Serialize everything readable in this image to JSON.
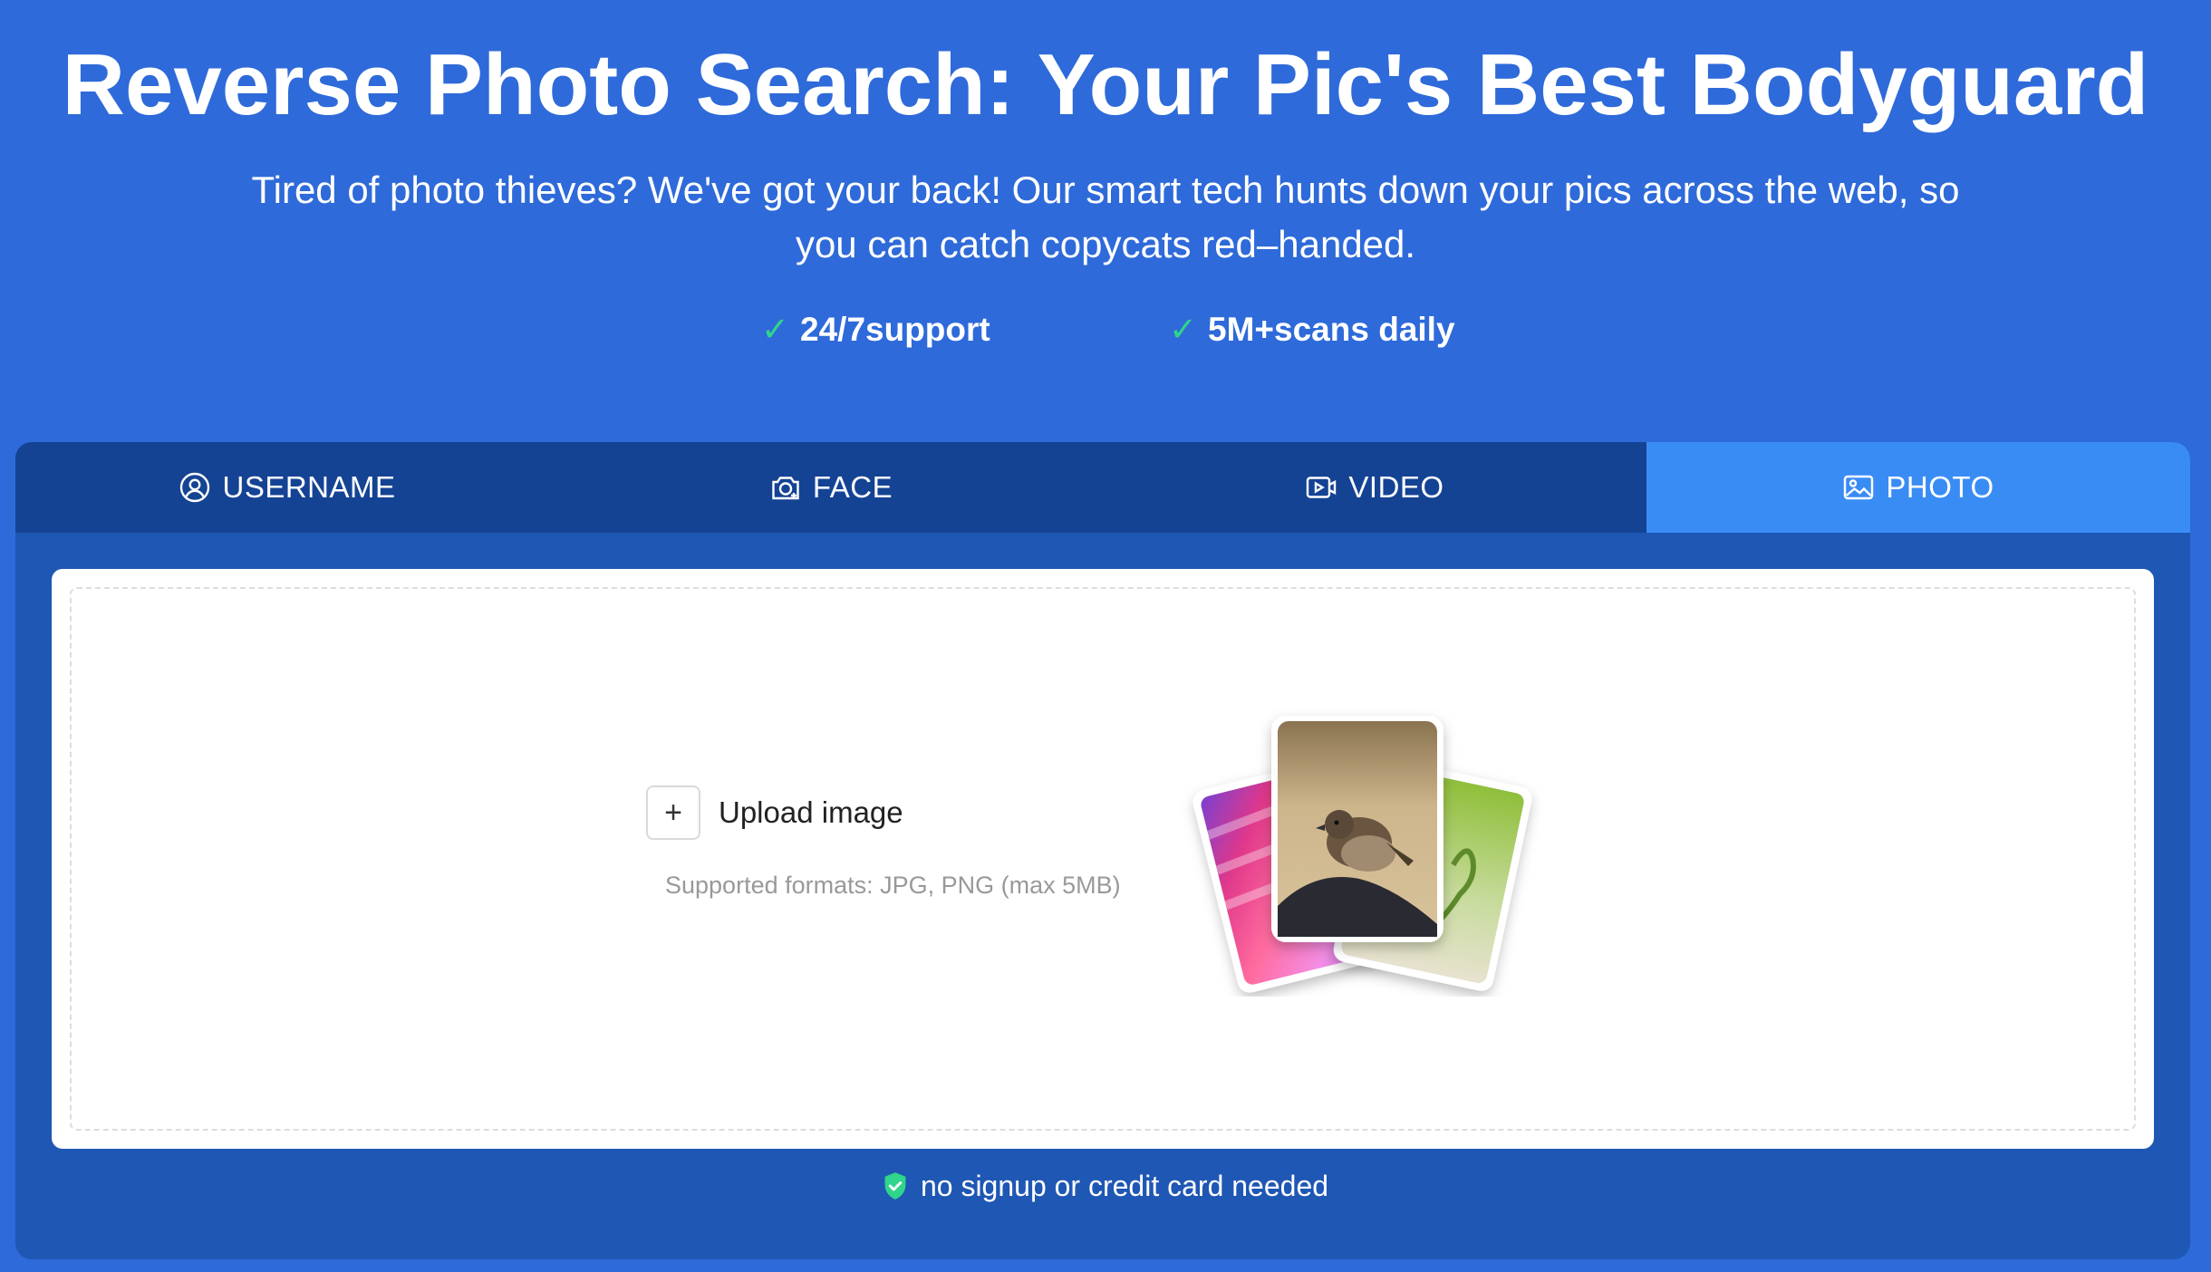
{
  "hero": {
    "title": "Reverse Photo Search: Your Pic's Best Bodyguard",
    "subtitle": "Tired of photo thieves? We've got your back! Our smart tech hunts down your pics across the web, so you can catch copycats red–handed."
  },
  "features": [
    {
      "check": "✓",
      "label": "24/7support"
    },
    {
      "check": "✓",
      "label": "5M+scans daily"
    }
  ],
  "tabs": [
    {
      "label": "USERNAME",
      "icon": "user-circle-icon",
      "active": false
    },
    {
      "label": "FACE",
      "icon": "face-scan-icon",
      "active": false
    },
    {
      "label": "VIDEO",
      "icon": "video-play-icon",
      "active": false
    },
    {
      "label": "PHOTO",
      "icon": "image-icon",
      "active": true
    }
  ],
  "upload": {
    "plus": "+",
    "label": "Upload image",
    "formats": "Supported formats: JPG, PNG (max 5MB)"
  },
  "note": {
    "icon": "shield-check-icon",
    "text": "no signup or credit card needed"
  },
  "colors": {
    "page_bg": "#2e6ad9",
    "tab_bar": "#154394",
    "tab_active": "#3a8cf5",
    "panel_bg": "#1f57b4",
    "check": "#2fd58a"
  }
}
